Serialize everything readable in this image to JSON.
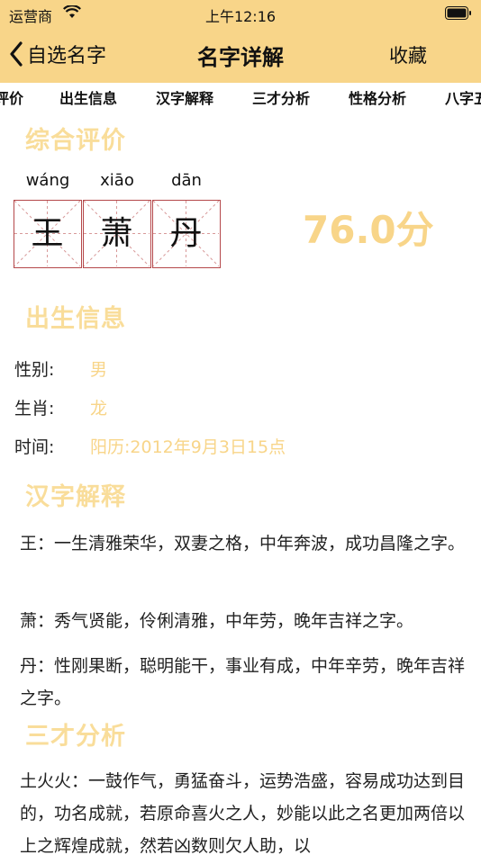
{
  "status": {
    "carrier": "运营商",
    "time": "上午12:16"
  },
  "nav": {
    "back_label": "自选名字",
    "title": "名字详解",
    "fav_label": "收藏"
  },
  "tabs": [
    "评价",
    "出生信息",
    "汉字解释",
    "三才分析",
    "性格分析",
    "八字五"
  ],
  "sections": {
    "overall": "综合评价",
    "birth": "出生信息",
    "hanzi": "汉字解释",
    "sancai": "三才分析"
  },
  "name": {
    "chars": [
      {
        "pinyin": "wáng",
        "char": "王"
      },
      {
        "pinyin": "xiāo",
        "char": "萧"
      },
      {
        "pinyin": "dān",
        "char": "丹"
      }
    ],
    "score": "76.0分"
  },
  "birth_info": {
    "gender_label": "性别:",
    "gender": "男",
    "zodiac_label": "生肖:",
    "zodiac": "龙",
    "time_label": "时间:",
    "time": "阳历:2012年9月3日15点"
  },
  "hanzi_explain": [
    "王：一生清雅荣华，双妻之格，中年奔波，成功昌隆之字。",
    "萧：秀气贤能，伶俐清雅，中年劳，晚年吉祥之字。",
    "丹：性刚果断，聪明能干，事业有成，中年辛劳，晚年吉祥之字。"
  ],
  "sancai_text": "土火火：一鼓作气，勇猛奋斗，运势浩盛，容易成功达到目的，功名成就，若原命喜火之人，妙能以此之名更加两倍以上之辉煌成就，然若凶数则欠人助，以",
  "colors": {
    "accent": "#f8d589",
    "section_title": "#f9dd9a",
    "grid_border": "#b5484a"
  }
}
